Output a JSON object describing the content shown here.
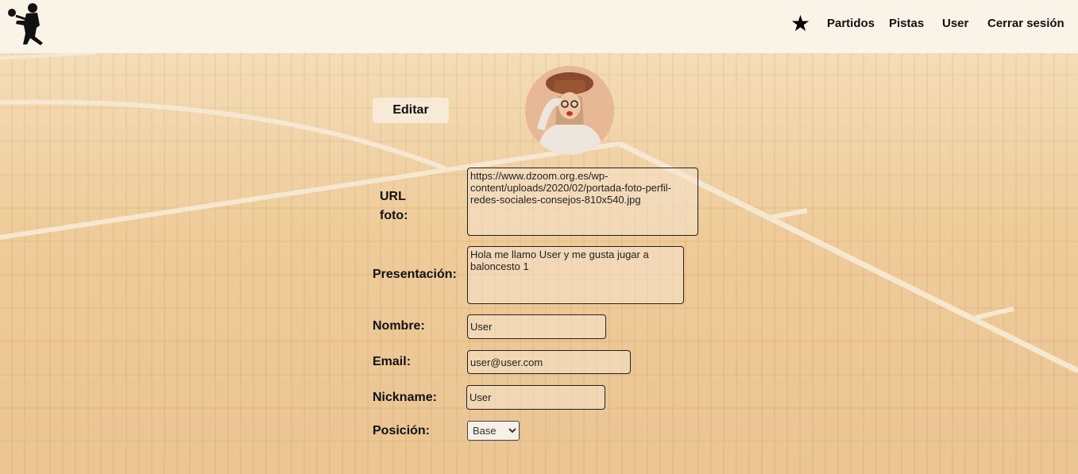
{
  "nav": {
    "star_icon": "star-icon",
    "items": [
      "Partidos",
      "Pistas",
      "User",
      "Cerrar sesión"
    ]
  },
  "profile": {
    "edit_label": "Editar",
    "url_label": "URL foto:",
    "url_value": "https://www.dzoom.org.es/wp-content/uploads/2020/02/portada-foto-perfil-redes-sociales-consejos-810x540.jpg",
    "presentation_label": "Presentación:",
    "presentation_value": "Hola me llamo User y me gusta jugar a baloncesto 1",
    "name_label": "Nombre:",
    "name_value": "User",
    "email_label": "Email:",
    "email_value": "user@user.com",
    "nickname_label": "Nickname:",
    "nickname_value": "User",
    "position_label": "Posición:",
    "position_value": "Base"
  },
  "colors": {
    "header_bg": "#faf3e8",
    "court": "#ecc68f",
    "lines": "#f8ecda"
  }
}
